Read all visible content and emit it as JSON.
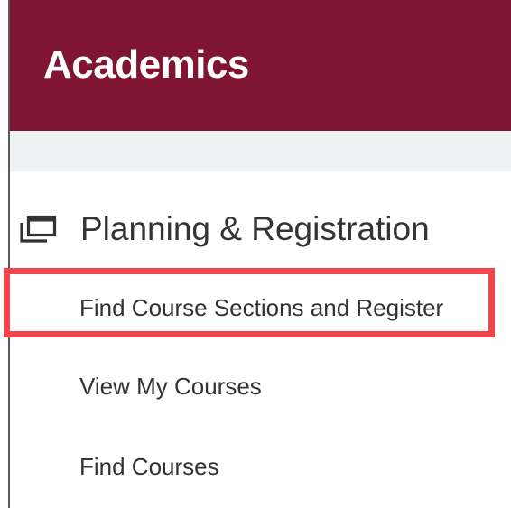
{
  "header": {
    "title": "Academics",
    "background_color": "#7f1530"
  },
  "section": {
    "icon": "stacked-windows-icon",
    "title": "Planning & Registration",
    "links": [
      {
        "label": "Find Course Sections and Register",
        "highlighted": true
      },
      {
        "label": "View My Courses",
        "highlighted": false
      },
      {
        "label": "Find Courses",
        "highlighted": false
      }
    ]
  },
  "colors": {
    "highlight": "#f2444a",
    "text": "#333333"
  }
}
